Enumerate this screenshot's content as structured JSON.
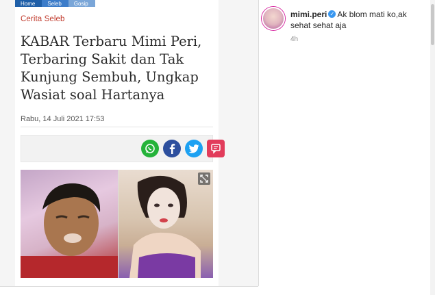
{
  "article": {
    "breadcrumb": [
      "Home",
      "Seleb",
      "Gosip"
    ],
    "category": "Cerita Seleb",
    "headline": "KABAR Terbaru Mimi Peri, Terbaring Sakit dan Tak Kunjung Sembuh, Ungkap Wasiat soal Hartanya",
    "date": "Rabu, 14 Juli 2021 17:53",
    "share_buttons": [
      {
        "name": "whatsapp",
        "icon": "whatsapp-icon",
        "color": "#25b33a"
      },
      {
        "name": "facebook",
        "icon": "facebook-icon",
        "color": "#2d4f9e"
      },
      {
        "name": "twitter",
        "icon": "twitter-icon",
        "color": "#1da1f2"
      },
      {
        "name": "comment",
        "icon": "comment-icon",
        "color": "#e23c5b"
      }
    ]
  },
  "comment": {
    "username": "mimi.peri",
    "verified": true,
    "text": "Ak blom mati ko,ak sehat sehat aja",
    "time": "4h"
  },
  "colors": {
    "category_red": "#c0392b",
    "verified_blue": "#3897f0",
    "breadcrumb_blue": "#1f5fa8"
  }
}
